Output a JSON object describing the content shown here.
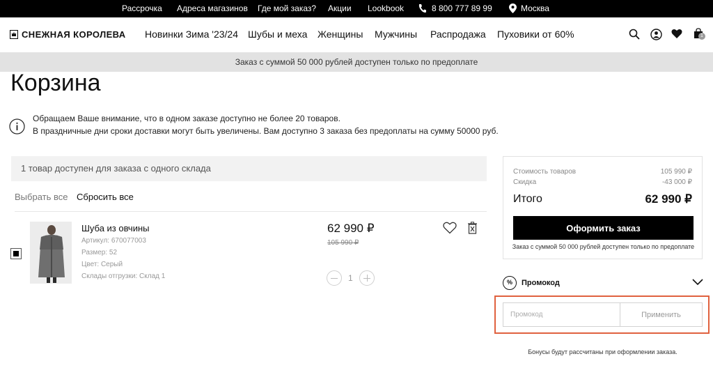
{
  "topbar": {
    "installment": "Рассрочка",
    "store_addresses": "Адреса магазинов",
    "where_order": "Где мой заказ?",
    "promotions": "Акции",
    "lookbook": "Lookbook",
    "phone": "8 800 777 89 99",
    "city": "Москва"
  },
  "header": {
    "logo": "СНЕЖНАЯ КОРОЛЕВА",
    "nav": [
      "Новинки Зима '23/24",
      "Шубы и меха",
      "Женщины",
      "Мужчины",
      "Распродажа",
      "Пуховики от 60%"
    ],
    "cart_count": "1"
  },
  "notice_bar": "Заказ с суммой 50 000 рублей доступен только по предоплате",
  "page_title": "Корзина",
  "info": {
    "line1": "Обращаем Ваше внимание, что в одном заказе доступно не более 20 товаров.",
    "line2": "В праздничные дни сроки доставки могут быть увеличены. Вам доступно 3 заказа без предоплаты на сумму 50000 руб."
  },
  "cart": {
    "availability": "1 товар доступен для заказа с одного склада",
    "select_all": "Выбрать все",
    "reset_all": "Сбросить все",
    "item": {
      "name": "Шуба из овчины",
      "article": "Артикул: 670077003",
      "size": "Размер: 52",
      "color": "Цвет: Серый",
      "warehouses": "Склады отгрузки: Склад 1",
      "price": "62 990 ₽",
      "old_price": "105 990 ₽",
      "quantity": "1",
      "selected": true
    }
  },
  "summary": {
    "goods_label": "Стоимость товаров",
    "goods_value": "105 990 ₽",
    "discount_label": "Скидка",
    "discount_value": "-43 000 ₽",
    "total_label": "Итого",
    "total_value": "62 990 ₽",
    "checkout": "Оформить заказ",
    "prepay_note": "Заказ с суммой 50 000 рублей доступен только по предоплате"
  },
  "promo": {
    "icon_text": "%",
    "label": "Промокод",
    "placeholder": "Промокод",
    "apply": "Применить",
    "bonus_note": "Бонусы будут рассчитаны при оформлении заказа.",
    "highlight_color": "#e0613e"
  }
}
